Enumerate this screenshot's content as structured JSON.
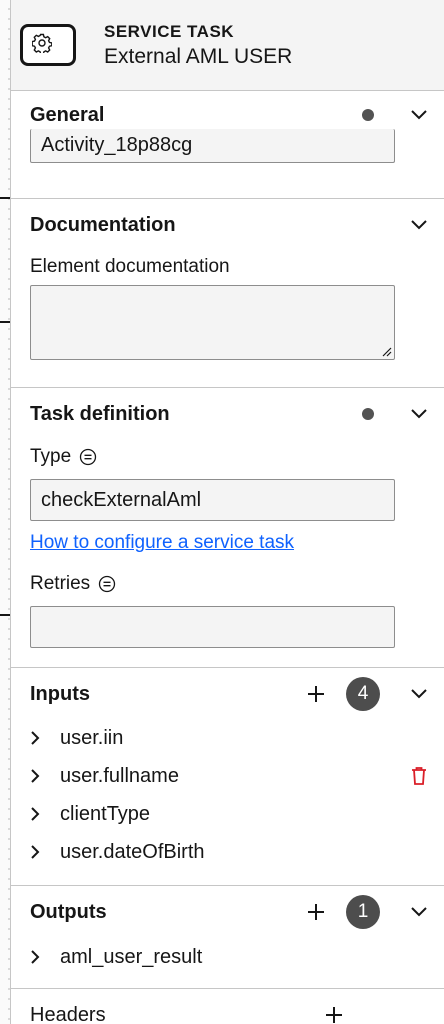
{
  "header": {
    "type_label": "SERVICE TASK",
    "element_name": "External AML USER",
    "icon": "gear-icon"
  },
  "general": {
    "title": "General",
    "id_value": "Activity_18p88cg"
  },
  "documentation": {
    "title": "Documentation",
    "field_label": "Element documentation",
    "value": ""
  },
  "task_definition": {
    "title": "Task definition",
    "type_label": "Type",
    "type_value": "checkExternalAml",
    "help_link": "How to configure a service task",
    "retries_label": "Retries",
    "retries_value": ""
  },
  "inputs": {
    "title": "Inputs",
    "count": "4",
    "items": [
      "user.iin",
      "user.fullname",
      "clientType",
      "user.dateOfBirth"
    ]
  },
  "outputs": {
    "title": "Outputs",
    "count": "1",
    "items": [
      "aml_user_result"
    ]
  },
  "headers": {
    "title": "Headers"
  },
  "colors": {
    "link": "#0f62fe",
    "delete": "#da1e28",
    "badge": "#4d4d4d"
  }
}
